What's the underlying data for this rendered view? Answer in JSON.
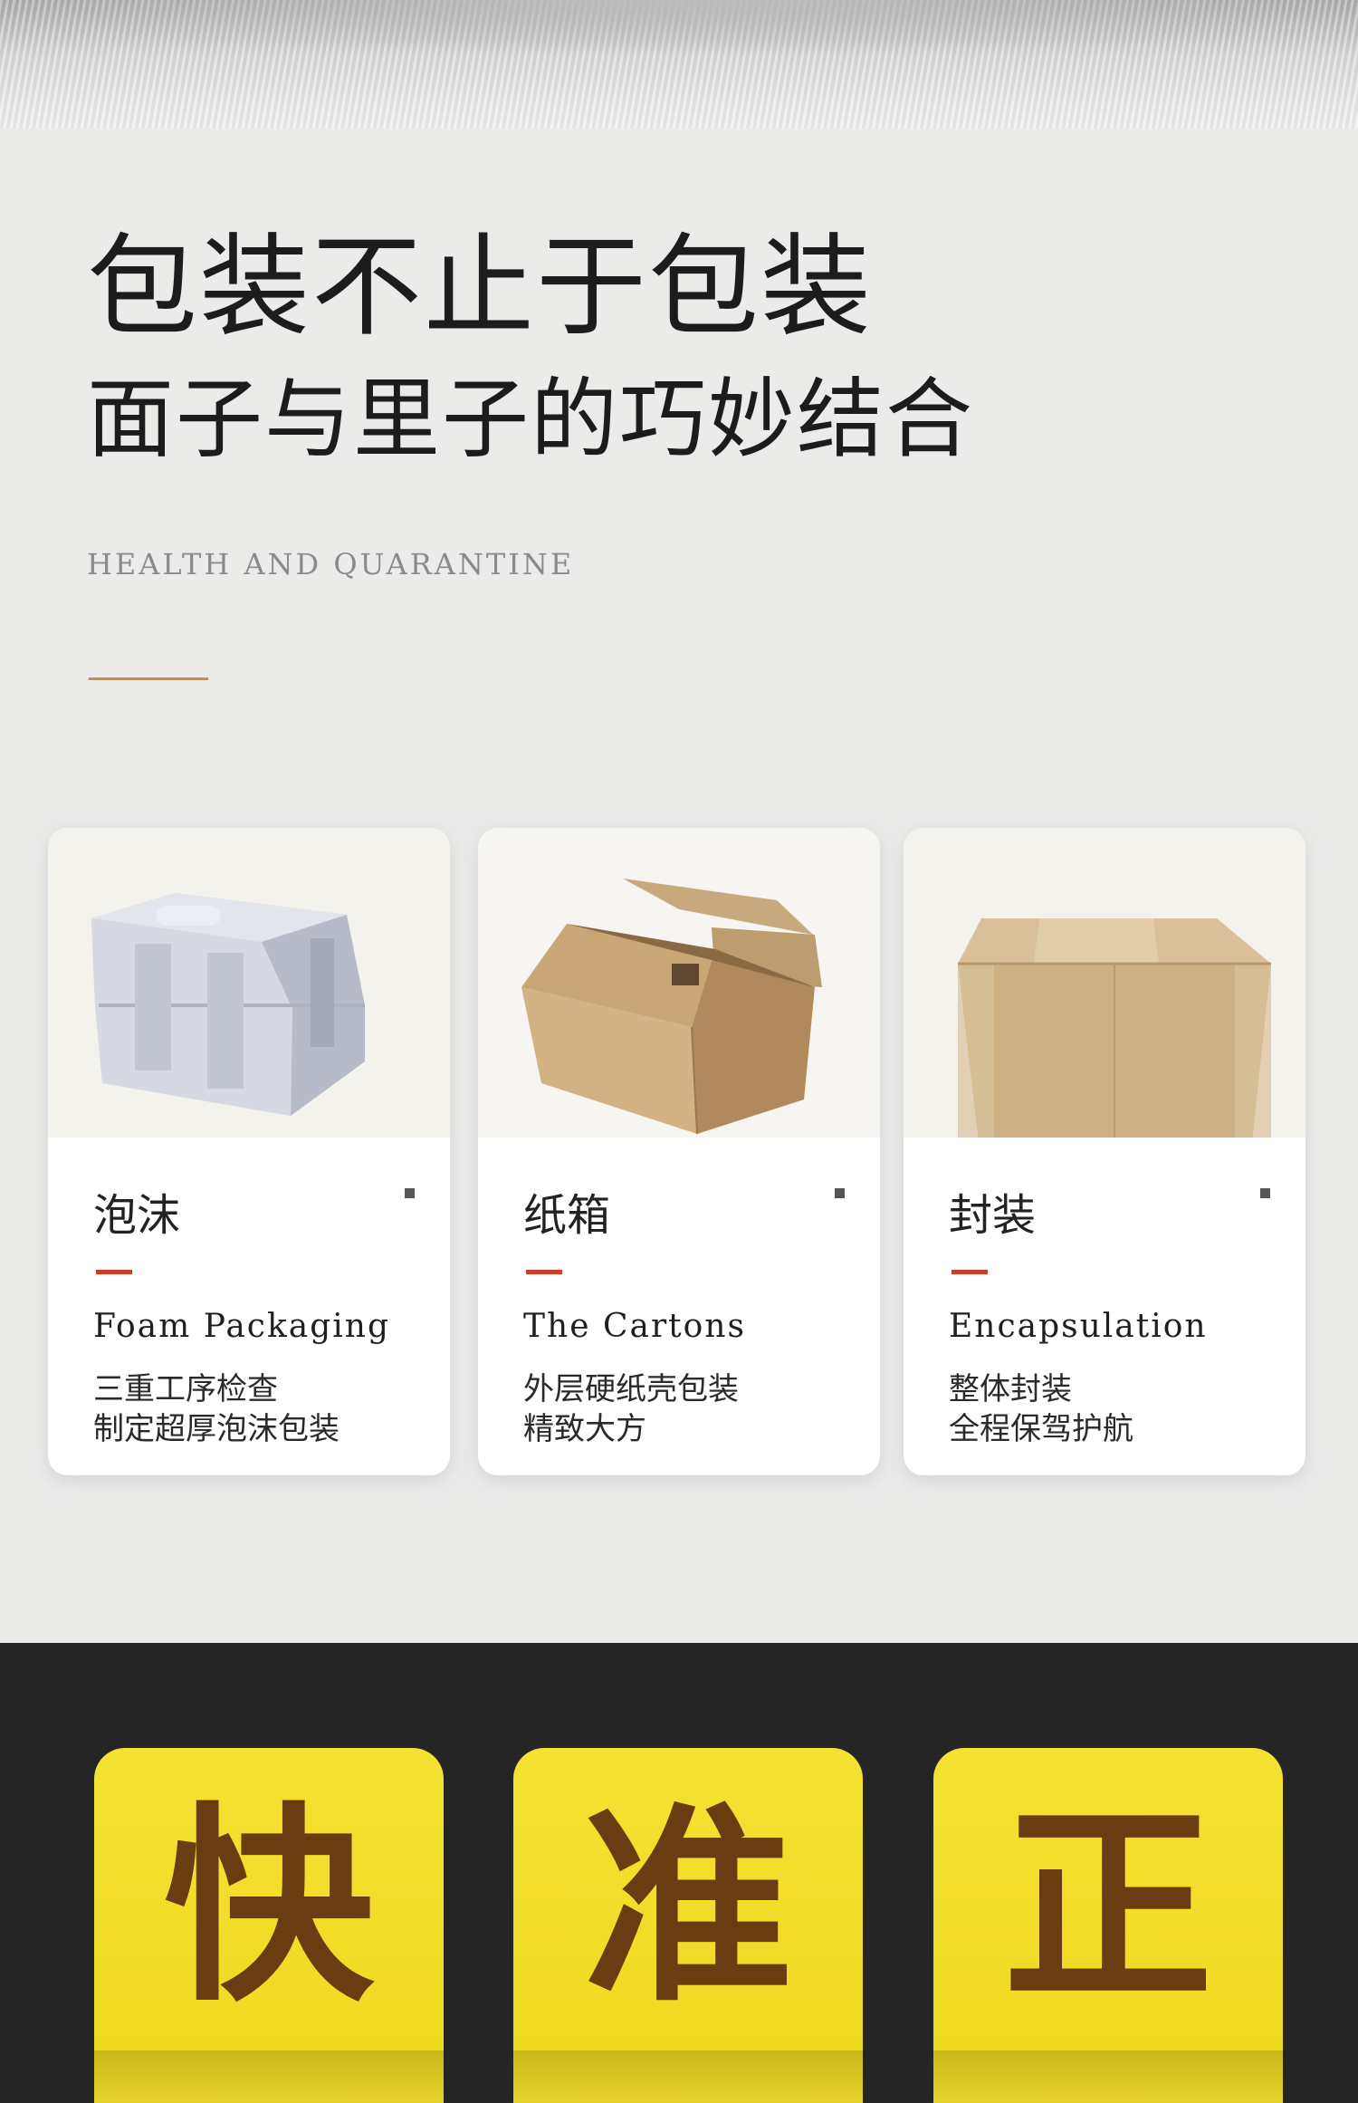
{
  "header": {
    "headline": "包装不止于包装",
    "subline": "面子与里子的巧妙结合",
    "en_caption": "HEALTH AND QUARANTINE"
  },
  "cards": [
    {
      "title": "泡沫",
      "en_title": "Foam Packaging",
      "desc_line1": "三重工序检查",
      "desc_line2": "制定超厚泡沫包装",
      "image_icon": "foam-box-image"
    },
    {
      "title": "纸箱",
      "en_title": "The Cartons",
      "desc_line1": "外层硬纸壳包装",
      "desc_line2": "精致大方",
      "image_icon": "open-carton-image"
    },
    {
      "title": "封装",
      "en_title": "Encapsulation",
      "desc_line1": "整体封装",
      "desc_line2": "全程保驾护航",
      "image_icon": "sealed-carton-image"
    }
  ],
  "tiles": [
    {
      "label": "快"
    },
    {
      "label": "准"
    },
    {
      "label": "正"
    }
  ],
  "colors": {
    "page_bg": "#ebebea",
    "accent_gold": "#b3926a",
    "accent_red": "#d23a2a",
    "dark_band": "#252525",
    "tile_yellow": "#eed91f",
    "tile_text": "#6a3c12"
  }
}
